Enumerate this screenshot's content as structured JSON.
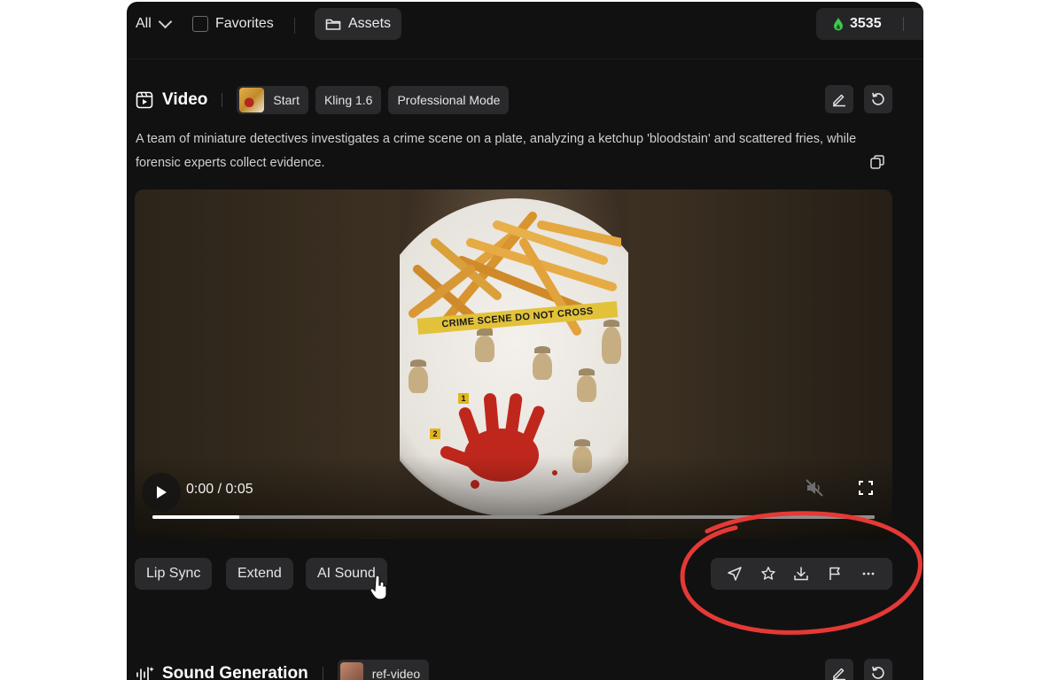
{
  "topbar": {
    "filter_label": "All",
    "favorites_label": "Favorites",
    "assets_label": "Assets",
    "credits_value": "3535"
  },
  "video_section": {
    "title": "Video",
    "start_label": "Start",
    "model_label": "Kling 1.6",
    "mode_label": "Professional Mode",
    "prompt": "A team of miniature detectives investigates a crime scene on a plate, analyzing a ketchup 'bloodstain' and scattered fries, while forensic experts collect evidence."
  },
  "player": {
    "time_display": "0:00 / 0:05",
    "progress_fraction": 0.12,
    "frame_tape_text": "CRIME SCENE DO NOT CROSS",
    "marker_1": "1",
    "marker_2": "2"
  },
  "actions": {
    "lip_sync_label": "Lip Sync",
    "extend_label": "Extend",
    "ai_sound_label": "AI Sound"
  },
  "toolbar_icons": [
    "send-icon",
    "star-icon",
    "download-icon",
    "flag-icon",
    "more-icon"
  ],
  "sound_section": {
    "title": "Sound Generation",
    "ref_label": "ref-video"
  },
  "colors": {
    "background": "#111112",
    "chip": "#2a2a2d",
    "credit_drop": "#3ec94a",
    "annotation_circle": "#e53935"
  }
}
